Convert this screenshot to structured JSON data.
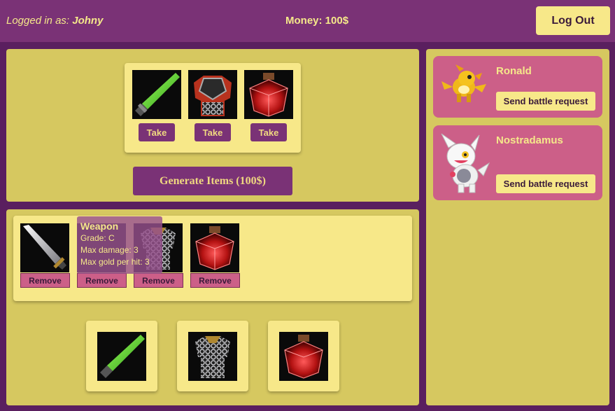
{
  "header": {
    "logged_in_prefix": "Logged in as:",
    "username": "Johny",
    "money_label": "Money: 100$",
    "logout_label": "Log Out"
  },
  "shop": {
    "items": [
      {
        "icon": "green-sword-icon",
        "take_label": "Take"
      },
      {
        "icon": "red-armor-icon",
        "take_label": "Take"
      },
      {
        "icon": "red-potion-icon",
        "take_label": "Take"
      }
    ],
    "generate_label": "Generate Items (100$)"
  },
  "inventory": {
    "items": [
      {
        "icon": "steel-sword-icon",
        "remove_label": "Remove"
      },
      {
        "icon": "hidden-item-icon",
        "remove_label": "Remove"
      },
      {
        "icon": "chainmail-icon",
        "remove_label": "Remove"
      },
      {
        "icon": "red-potion-icon",
        "remove_label": "Remove"
      }
    ],
    "tooltip": {
      "title": "Weapon",
      "grade": "Grade: C",
      "max_damage": "Max damage: 3",
      "max_gold": "Max gold per hit: 3"
    }
  },
  "equipment": {
    "slots": [
      {
        "icon": "green-sword-icon"
      },
      {
        "icon": "chainmail-icon"
      },
      {
        "icon": "red-potion-icon"
      }
    ]
  },
  "players": [
    {
      "name": "Ronald",
      "avatar": "yellow-creature-avatar",
      "battle_label": "Send battle request"
    },
    {
      "name": "Nostradamus",
      "avatar": "white-creature-avatar",
      "battle_label": "Send battle request"
    }
  ],
  "colors": {
    "background": "#5a1f5f",
    "header": "#7a3276",
    "panel": "#d6c860",
    "box": "#f7e889",
    "accent_purple": "#7a3276",
    "card_pink": "#cc5f88",
    "text_yellow": "#f5e88a"
  }
}
